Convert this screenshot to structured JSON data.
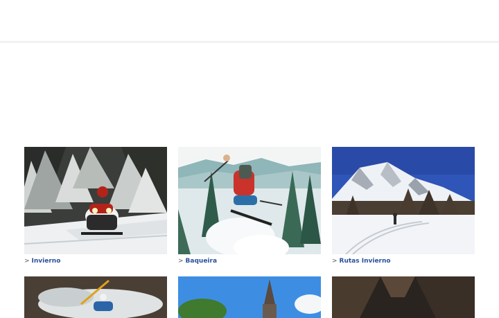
{
  "header": {},
  "categories": [
    {
      "label": "Invierno",
      "arrow": ">"
    },
    {
      "label": "Baqueira",
      "arrow": ">"
    },
    {
      "label": "Rutas Invierno",
      "arrow": ">"
    }
  ],
  "colors": {
    "link": "#2a4f9a",
    "divider": "#f1f1f1",
    "background": "#ffffff"
  }
}
